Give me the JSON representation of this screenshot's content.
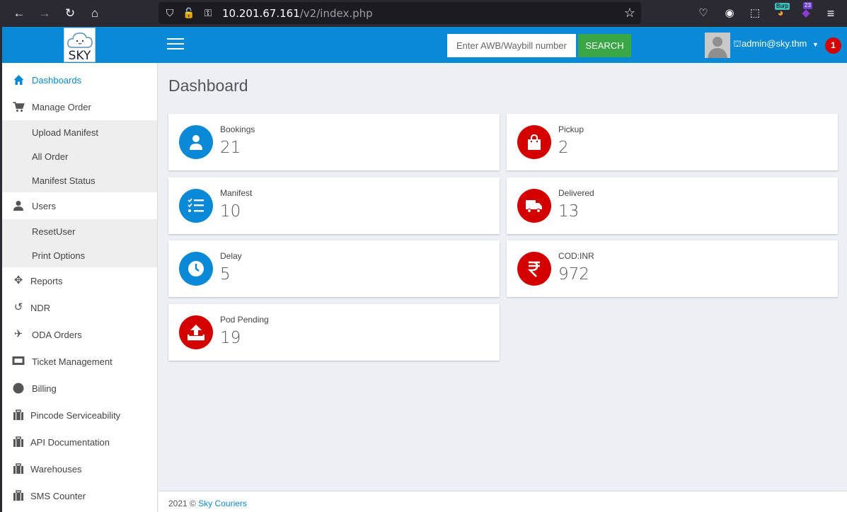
{
  "browser": {
    "url_host": "10.201.67.161",
    "url_path": "/v2/index.php",
    "extensions": {
      "burp_label": "Burp",
      "badge_count": "23"
    }
  },
  "header": {
    "logo_text": "SKY",
    "search_placeholder": "Enter AWB/Waybill number",
    "search_button": "SEARCH",
    "user": "admin@sky.thm",
    "notification_count": "1",
    "colors": {
      "primary": "#0a8ad6",
      "search_button": "#39a745",
      "badge": "#d40000"
    }
  },
  "sidebar": {
    "items": [
      {
        "label": "Dashboards",
        "icon": "home-icon",
        "active": true
      },
      {
        "label": "Manage Order",
        "icon": "cart-icon"
      },
      {
        "label": "Upload Manifest",
        "sub": true
      },
      {
        "label": "All Order",
        "sub": true
      },
      {
        "label": "Manifest Status",
        "sub": true
      },
      {
        "label": "Users",
        "icon": "user-icon"
      },
      {
        "label": "ResetUser",
        "sub": true
      },
      {
        "label": "Print Options",
        "sub": true
      },
      {
        "label": "Reports",
        "icon": "pinwheel-icon"
      },
      {
        "label": "NDR",
        "icon": "undo-icon"
      },
      {
        "label": "ODA Orders",
        "icon": "plane-icon"
      },
      {
        "label": "Ticket Management",
        "icon": "ticket-icon"
      },
      {
        "label": "Billing",
        "icon": "circle-icon"
      },
      {
        "label": "Pincode Serviceability",
        "icon": "suitcase-icon"
      },
      {
        "label": "API Documentation",
        "icon": "suitcase-icon"
      },
      {
        "label": "Warehouses",
        "icon": "suitcase-icon"
      },
      {
        "label": "SMS Counter",
        "icon": "suitcase-icon"
      }
    ]
  },
  "main": {
    "title": "Dashboard",
    "cards": [
      {
        "label": "Bookings",
        "value": "21",
        "icon": "user-icon",
        "color": "blue"
      },
      {
        "label": "Pickup",
        "value": "2",
        "icon": "shopping-bag-icon",
        "color": "red"
      },
      {
        "label": "Manifest",
        "value": "10",
        "icon": "checklist-icon",
        "color": "blue"
      },
      {
        "label": "Delivered",
        "value": "13",
        "icon": "truck-icon",
        "color": "red"
      },
      {
        "label": "Delay",
        "value": "5",
        "icon": "clock-icon",
        "color": "blue"
      },
      {
        "label": "COD:INR",
        "value": "972",
        "icon": "rupee-icon",
        "color": "red"
      },
      {
        "label": "Pod Pending",
        "value": "19",
        "icon": "upload-icon",
        "color": "red"
      }
    ]
  },
  "footer": {
    "year": "2021 ©",
    "company": "Sky Couriers"
  }
}
